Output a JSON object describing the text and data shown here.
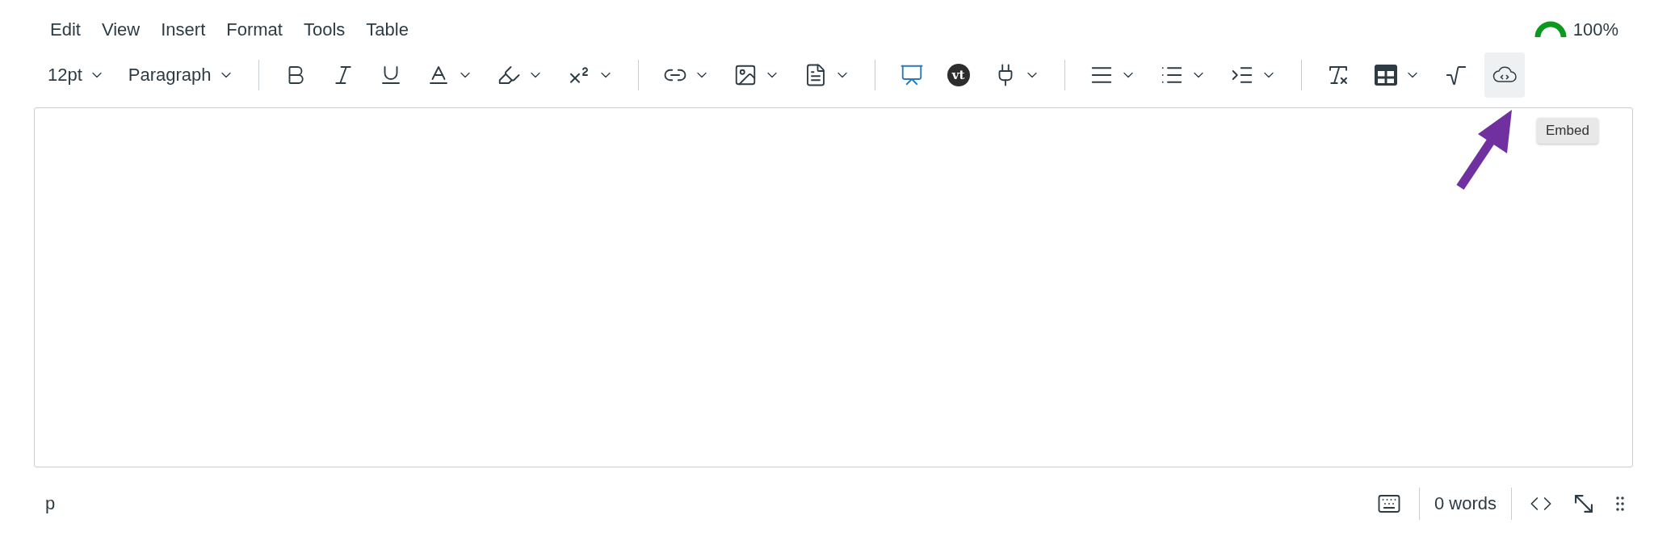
{
  "menu_bar": [
    {
      "label": "Edit"
    },
    {
      "label": "View"
    },
    {
      "label": "Insert"
    },
    {
      "label": "Format"
    },
    {
      "label": "Tools"
    },
    {
      "label": "Table"
    }
  ],
  "accessibility_meter": {
    "level": 1,
    "reading": "100%"
  },
  "toolbar": [
    {
      "kind": "select",
      "label": "12pt",
      "has_menu": true,
      "highlighted": false
    },
    {
      "kind": "select",
      "label": "Paragraph",
      "has_menu": true,
      "highlighted": false
    },
    {
      "kind": "separator"
    },
    {
      "kind": "icon",
      "has_menu": false,
      "highlighted": false
    },
    {
      "kind": "icon",
      "has_menu": false,
      "highlighted": false
    },
    {
      "kind": "icon",
      "has_menu": false,
      "highlighted": false
    },
    {
      "kind": "icon",
      "has_menu": true,
      "highlighted": false
    },
    {
      "kind": "icon",
      "has_menu": true,
      "highlighted": false
    },
    {
      "kind": "icon",
      "has_menu": true,
      "highlighted": false
    },
    {
      "kind": "separator"
    },
    {
      "kind": "icon",
      "has_menu": true,
      "highlighted": false
    },
    {
      "kind": "icon",
      "has_menu": true,
      "highlighted": false
    },
    {
      "kind": "icon",
      "has_menu": true,
      "highlighted": false
    },
    {
      "kind": "separator"
    },
    {
      "kind": "icon",
      "has_menu": false,
      "highlighted": false
    },
    {
      "kind": "badge",
      "label": "vt",
      "has_menu": false,
      "highlighted": false
    },
    {
      "kind": "icon",
      "has_menu": true,
      "highlighted": false
    },
    {
      "kind": "separator"
    },
    {
      "kind": "icon",
      "has_menu": true,
      "highlighted": false
    },
    {
      "kind": "icon",
      "has_menu": true,
      "highlighted": false
    },
    {
      "kind": "icon",
      "has_menu": true,
      "highlighted": false
    },
    {
      "kind": "separator"
    },
    {
      "kind": "icon",
      "has_menu": false,
      "highlighted": false
    },
    {
      "kind": "icon",
      "has_menu": true,
      "highlighted": false
    },
    {
      "kind": "icon",
      "has_menu": false,
      "highlighted": false
    },
    {
      "kind": "icon",
      "has_menu": false,
      "highlighted": true,
      "tooltip": "Embed"
    }
  ],
  "status_bar": {
    "path": "p",
    "word_count": "0 words"
  }
}
